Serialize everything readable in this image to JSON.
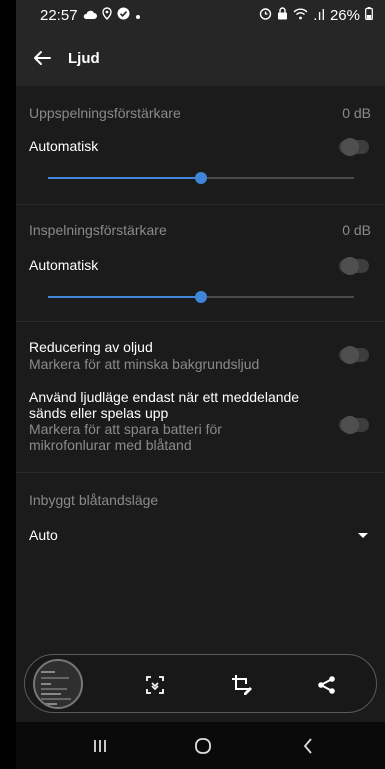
{
  "status_bar": {
    "time": "22:57",
    "signal": ".ıl",
    "battery": "26%"
  },
  "header": {
    "title": "Ljud",
    "back_icon": "arrow-left-icon"
  },
  "playback_gain": {
    "label": "Uppspelningsförstärkare",
    "value": "0 dB",
    "auto_label": "Automatisk",
    "auto_enabled": false,
    "slider_level": 0.5
  },
  "recording_gain": {
    "label": "Inspelningsförstärkare",
    "value": "0 dB",
    "auto_label": "Automatisk",
    "auto_enabled": false,
    "slider_level": 0.5
  },
  "noise_reduction": {
    "title": "Reducering av oljud",
    "subtitle": "Markera för att minska bakgrundsljud",
    "enabled": false
  },
  "audio_mode": {
    "title_line1": "Använd ljudläge endast när ett meddelande",
    "title_line2": "sänds eller spelas upp",
    "subtitle_line1": "Markera för att spara batteri för",
    "subtitle_line2": "mikrofonlurar med blåtand",
    "enabled": false
  },
  "bluetooth_mode": {
    "label": "Inbyggt blåtandsläge",
    "selected": "Auto"
  },
  "colors": {
    "accent": "#3f86d8",
    "background": "#1b1b1b",
    "appbar": "#262626"
  }
}
